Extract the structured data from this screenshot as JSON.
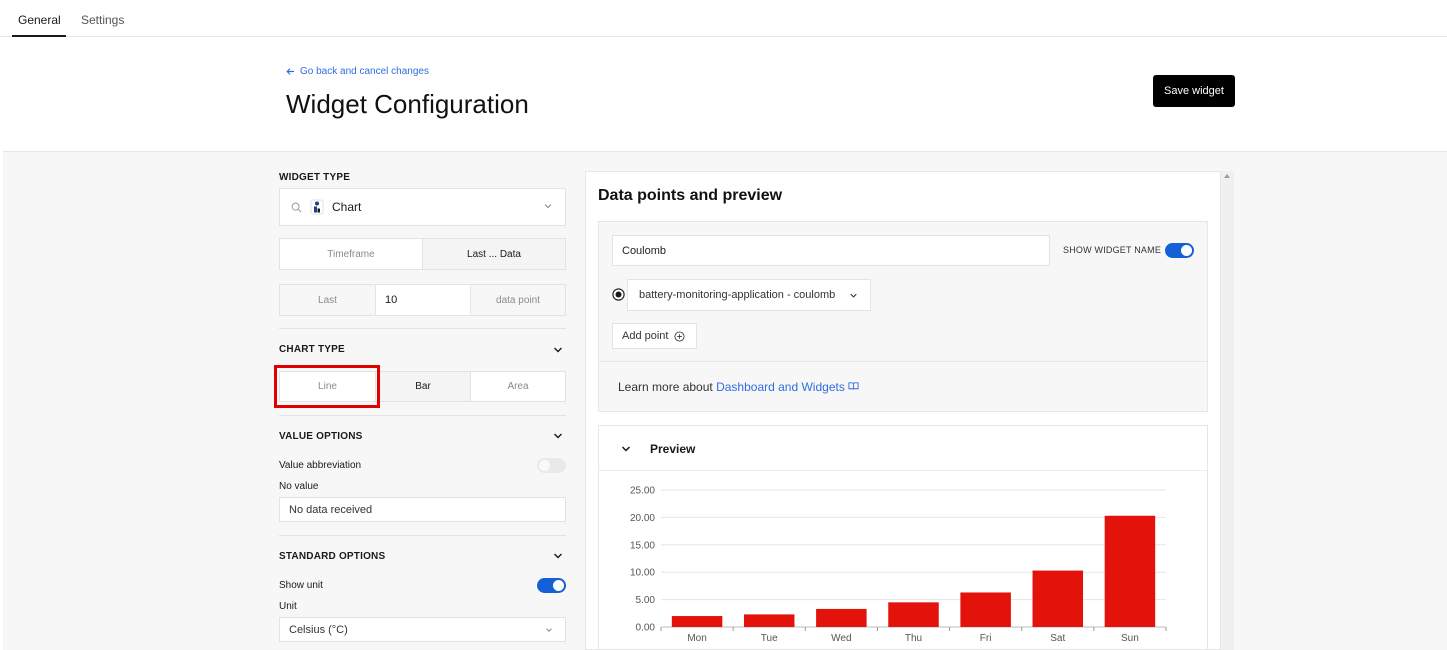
{
  "tabs": [
    {
      "label": "General",
      "active": true
    },
    {
      "label": "Settings",
      "active": false
    }
  ],
  "header": {
    "back_link": "Go back and cancel changes",
    "title": "Widget Configuration",
    "save_button": "Save widget"
  },
  "left_panel": {
    "widget_type": {
      "label": "WIDGET TYPE",
      "selected": "Chart",
      "icon": "chart-widget-icon"
    },
    "timeframe_toggle": {
      "options": [
        "Timeframe",
        "Last ... Data"
      ],
      "active": "Last ... Data"
    },
    "last_points": {
      "prefix": "Last",
      "value": "10",
      "suffix": "data point"
    },
    "chart_type": {
      "label": "CHART TYPE",
      "options": [
        "Line",
        "Bar",
        "Area"
      ],
      "selected": "Bar"
    },
    "value_options": {
      "label": "VALUE OPTIONS",
      "abbreviation_label": "Value abbreviation",
      "abbreviation_enabled": false,
      "no_value_label": "No value",
      "no_value_text": "No data received"
    },
    "standard_options": {
      "label": "STANDARD OPTIONS",
      "show_unit_label": "Show unit",
      "show_unit_enabled": true,
      "unit_label": "Unit",
      "unit_value": "Celsius (°C)"
    }
  },
  "right_panel": {
    "title": "Data points and preview",
    "widget_name": "Coulomb",
    "show_widget_name_label": "SHOW WIDGET NAME",
    "show_widget_name_enabled": true,
    "data_point": "battery-monitoring-application - coulomb",
    "add_point": "Add point",
    "learn_more_prefix": "Learn more about",
    "learn_more_link": "Dashboard and Widgets",
    "preview_label": "Preview"
  },
  "colors": {
    "accent": "#1560d4",
    "link": "#2f6fde",
    "bar": "#e3120b",
    "highlight": "#e00000"
  },
  "chart_data": {
    "type": "bar",
    "categories": [
      "Mon",
      "Tue",
      "Wed",
      "Thu",
      "Fri",
      "Sat",
      "Sun"
    ],
    "values": [
      2.0,
      2.3,
      3.3,
      4.5,
      6.3,
      10.3,
      20.3
    ],
    "y_ticks": [
      "0.00",
      "5.00",
      "10.00",
      "15.00",
      "20.00",
      "25.00"
    ],
    "ylim": [
      0,
      25
    ],
    "grid": true
  }
}
